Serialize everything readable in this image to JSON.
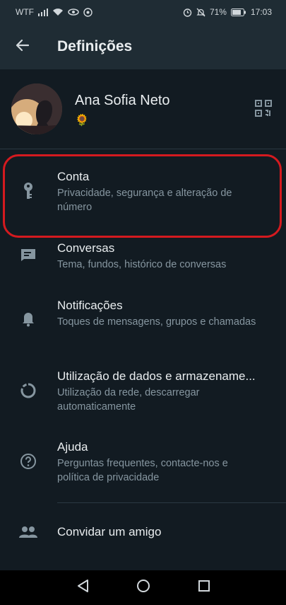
{
  "status_bar": {
    "carrier": "WTF",
    "battery": "71%",
    "time": "17:03"
  },
  "app_bar": {
    "title": "Definições",
    "back_icon": "arrow-left-icon"
  },
  "profile": {
    "name": "Ana Sofia Neto",
    "about": "🌻",
    "qr_icon": "qr-code-icon"
  },
  "settings": [
    {
      "icon": "key-icon",
      "title": "Conta",
      "subtitle": "Privacidade, segurança e alteração de número"
    },
    {
      "icon": "chat-icon",
      "title": "Conversas",
      "subtitle": "Tema, fundos, histórico de conversas"
    },
    {
      "icon": "bell-icon",
      "title": "Notificações",
      "subtitle": "Toques de mensagens, grupos e chamadas"
    },
    {
      "icon": "data-usage-icon",
      "title": "Utilização de dados e armazename...",
      "subtitle": "Utilização da rede, descarregar automaticamente"
    },
    {
      "icon": "help-icon",
      "title": "Ajuda",
      "subtitle": "Perguntas frequentes, contacte-nos e política de privacidade"
    },
    {
      "icon": "people-icon",
      "title": "Convidar um amigo",
      "subtitle": ""
    }
  ],
  "colors": {
    "background": "#121b22",
    "bar": "#1f2c34",
    "highlight": "#d41a1f",
    "secondary_text": "#8696a0"
  }
}
